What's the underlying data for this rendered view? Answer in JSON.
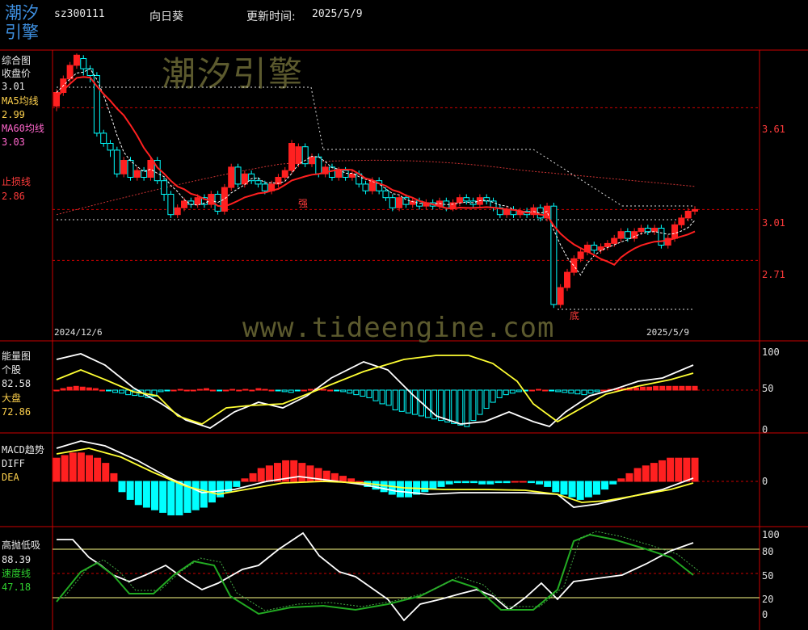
{
  "header": {
    "logo": "潮汐引擎",
    "code": "sz300111",
    "name": "向日葵",
    "update_label": "更新时间:",
    "update_date": "2025/5/9"
  },
  "watermark": {
    "brand": "潮汐引擎",
    "url": "www.tideengine.com"
  },
  "colors": {
    "up": "#ff2020",
    "down": "#00ffff",
    "ma5": "#ffffff",
    "ma60": "#ff2020",
    "grid": "#cc0000",
    "yellow": "#ffff33",
    "green": "#22aa22"
  },
  "panel1": {
    "title": "综合图",
    "close_label": "收盘价",
    "close_value": "3.01",
    "ma5_label": "MA5均线",
    "ma5_value": "2.99",
    "ma60_label": "MA60均线",
    "ma60_value": "3.03",
    "stop_label": "止损线",
    "stop_value": "2.86",
    "y_ticks": [
      "3.61",
      "3.01",
      "2.71"
    ],
    "date_start": "2024/12/6",
    "date_end": "2025/5/9",
    "marker_strong": "强",
    "marker_bottom": "底"
  },
  "panel2": {
    "title": "能量图",
    "stock_label": "个股",
    "stock_value": "82.58",
    "market_label": "大盘",
    "market_value": "72.86",
    "y_ticks": [
      "100",
      "50",
      "0"
    ]
  },
  "panel3": {
    "title": "MACD趋势",
    "diff_label": "DIFF",
    "dea_label": "DEA",
    "y_ticks": [
      "0"
    ]
  },
  "panel4": {
    "title": "高抛低吸",
    "value": "88.39",
    "speed_label": "速度线",
    "speed_value": "47.18",
    "y_ticks": [
      "100",
      "80",
      "50",
      "20",
      "0"
    ]
  },
  "chart_data": {
    "type": "candlestick",
    "x_range": [
      "2024/12/6",
      "2025/5/9"
    ],
    "price_ylim": [
      2.35,
      3.95
    ],
    "candles": [
      [
        3.62,
        3.7,
        3.59,
        3.72
      ],
      [
        3.7,
        3.78,
        3.68,
        3.8
      ],
      [
        3.78,
        3.86,
        3.76,
        3.88
      ],
      [
        3.86,
        3.92,
        3.84,
        3.93
      ],
      [
        3.9,
        3.84,
        3.8,
        3.92
      ],
      [
        3.84,
        3.8,
        3.76,
        3.86
      ],
      [
        3.8,
        3.46,
        3.44,
        3.82
      ],
      [
        3.46,
        3.4,
        3.38,
        3.48
      ],
      [
        3.4,
        3.36,
        3.32,
        3.42
      ],
      [
        3.36,
        3.22,
        3.2,
        3.38
      ],
      [
        3.22,
        3.3,
        3.2,
        3.32
      ],
      [
        3.3,
        3.2,
        3.18,
        3.32
      ],
      [
        3.2,
        3.24,
        3.18,
        3.26
      ],
      [
        3.24,
        3.2,
        3.18,
        3.26
      ],
      [
        3.2,
        3.3,
        3.18,
        3.32
      ],
      [
        3.3,
        3.18,
        3.16,
        3.32
      ],
      [
        3.18,
        3.1,
        3.06,
        3.2
      ],
      [
        3.1,
        2.98,
        2.96,
        3.12
      ],
      [
        2.98,
        3.02,
        2.96,
        3.04
      ],
      [
        3.02,
        3.06,
        3.0,
        3.08
      ],
      [
        3.06,
        3.04,
        3.02,
        3.08
      ],
      [
        3.04,
        3.08,
        3.02,
        3.1
      ],
      [
        3.08,
        3.04,
        3.02,
        3.1
      ],
      [
        3.04,
        3.1,
        3.02,
        3.12
      ],
      [
        3.1,
        3.0,
        2.98,
        3.12
      ],
      [
        3.0,
        3.14,
        2.98,
        3.16
      ],
      [
        3.14,
        3.26,
        3.12,
        3.28
      ],
      [
        3.26,
        3.16,
        3.14,
        3.28
      ],
      [
        3.16,
        3.22,
        3.14,
        3.24
      ],
      [
        3.22,
        3.18,
        3.16,
        3.24
      ],
      [
        3.18,
        3.16,
        3.14,
        3.2
      ],
      [
        3.16,
        3.12,
        3.1,
        3.18
      ],
      [
        3.12,
        3.16,
        3.1,
        3.18
      ],
      [
        3.16,
        3.2,
        3.14,
        3.22
      ],
      [
        3.2,
        3.24,
        3.18,
        3.26
      ],
      [
        3.24,
        3.4,
        3.22,
        3.42
      ],
      [
        3.28,
        3.38,
        3.26,
        3.4
      ],
      [
        3.38,
        3.28,
        3.26,
        3.4
      ],
      [
        3.28,
        3.32,
        3.26,
        3.34
      ],
      [
        3.32,
        3.22,
        3.2,
        3.34
      ],
      [
        3.22,
        3.26,
        3.2,
        3.28
      ],
      [
        3.26,
        3.2,
        3.18,
        3.28
      ],
      [
        3.2,
        3.24,
        3.18,
        3.26
      ],
      [
        3.24,
        3.2,
        3.18,
        3.26
      ],
      [
        3.2,
        3.22,
        3.18,
        3.24
      ],
      [
        3.22,
        3.16,
        3.14,
        3.24
      ],
      [
        3.16,
        3.12,
        3.1,
        3.18
      ],
      [
        3.12,
        3.18,
        3.1,
        3.2
      ],
      [
        3.18,
        3.12,
        3.1,
        3.2
      ],
      [
        3.12,
        3.08,
        3.06,
        3.14
      ],
      [
        3.08,
        3.02,
        3.0,
        3.1
      ],
      [
        3.02,
        3.08,
        3.0,
        3.1
      ],
      [
        3.08,
        3.04,
        3.02,
        3.1
      ],
      [
        3.04,
        3.06,
        3.02,
        3.08
      ],
      [
        3.06,
        3.03,
        3.01,
        3.08
      ],
      [
        3.03,
        3.05,
        3.01,
        3.07
      ],
      [
        3.05,
        3.03,
        3.01,
        3.07
      ],
      [
        3.03,
        3.06,
        3.01,
        3.08
      ],
      [
        3.06,
        3.02,
        3.0,
        3.08
      ],
      [
        3.02,
        3.05,
        3.0,
        3.07
      ],
      [
        3.05,
        3.08,
        3.03,
        3.1
      ],
      [
        3.08,
        3.06,
        3.04,
        3.1
      ],
      [
        3.06,
        3.04,
        3.02,
        3.08
      ],
      [
        3.04,
        3.08,
        3.02,
        3.1
      ],
      [
        3.08,
        3.06,
        3.04,
        3.1
      ],
      [
        3.06,
        3.02,
        3.0,
        3.08
      ],
      [
        3.02,
        2.98,
        2.96,
        3.04
      ],
      [
        2.98,
        3.01,
        2.96,
        3.03
      ],
      [
        3.01,
        2.98,
        2.96,
        3.03
      ],
      [
        2.98,
        3.0,
        2.96,
        3.02
      ],
      [
        3.0,
        2.98,
        2.96,
        3.02
      ],
      [
        2.98,
        3.02,
        2.96,
        3.04
      ],
      [
        3.02,
        2.96,
        2.94,
        3.04
      ],
      [
        2.96,
        3.03,
        2.94,
        3.05
      ],
      [
        3.03,
        2.45,
        2.43,
        3.05
      ],
      [
        2.45,
        2.55,
        2.43,
        2.57
      ],
      [
        2.55,
        2.64,
        2.53,
        2.66
      ],
      [
        2.64,
        2.72,
        2.62,
        2.74
      ],
      [
        2.72,
        2.76,
        2.7,
        2.78
      ],
      [
        2.76,
        2.8,
        2.74,
        2.82
      ],
      [
        2.8,
        2.77,
        2.75,
        2.82
      ],
      [
        2.77,
        2.79,
        2.75,
        2.81
      ],
      [
        2.79,
        2.81,
        2.77,
        2.83
      ],
      [
        2.81,
        2.84,
        2.79,
        2.86
      ],
      [
        2.84,
        2.88,
        2.82,
        2.9
      ],
      [
        2.88,
        2.84,
        2.82,
        2.9
      ],
      [
        2.84,
        2.88,
        2.82,
        2.9
      ],
      [
        2.88,
        2.9,
        2.86,
        2.92
      ],
      [
        2.9,
        2.88,
        2.86,
        2.92
      ],
      [
        2.88,
        2.9,
        2.86,
        2.92
      ],
      [
        2.9,
        2.8,
        2.78,
        2.92
      ],
      [
        2.8,
        2.84,
        2.78,
        2.86
      ],
      [
        2.84,
        2.92,
        2.82,
        2.94
      ],
      [
        2.92,
        2.96,
        2.9,
        2.98
      ],
      [
        2.96,
        3.0,
        2.94,
        3.02
      ],
      [
        3.0,
        3.01,
        2.98,
        3.03
      ]
    ],
    "volume_energy_bars": [
      50,
      52,
      54,
      55,
      54,
      53,
      52,
      50,
      49,
      47,
      46,
      44,
      43,
      42,
      40,
      42,
      48,
      49,
      50,
      51,
      50,
      50,
      51,
      52,
      50,
      49,
      50,
      51,
      50,
      51,
      50,
      52,
      51,
      50,
      49,
      48,
      47,
      49,
      50,
      51,
      52,
      51,
      50,
      49,
      48,
      46,
      44,
      42,
      40,
      36,
      32,
      30,
      24,
      22,
      20,
      18,
      16,
      14,
      12,
      10,
      8,
      6,
      4,
      2,
      10,
      18,
      26,
      34,
      40,
      44,
      46,
      48,
      49,
      50,
      51,
      50,
      49,
      48,
      47,
      46,
      45,
      44,
      46,
      48,
      50,
      51,
      52,
      52,
      53,
      53,
      54,
      54,
      55,
      55,
      55,
      55,
      55,
      55,
      55
    ],
    "macd_bars": [
      18,
      20,
      22,
      22,
      20,
      18,
      14,
      6,
      -8,
      -14,
      -18,
      -20,
      -22,
      -24,
      -26,
      -26,
      -24,
      -22,
      -20,
      -16,
      -12,
      -8,
      -4,
      2,
      6,
      10,
      12,
      14,
      16,
      16,
      14,
      12,
      10,
      8,
      6,
      4,
      2,
      0,
      -4,
      -6,
      -8,
      -10,
      -12,
      -12,
      -10,
      -8,
      -6,
      -4,
      -2,
      -1,
      -1,
      -1,
      -2,
      -2,
      -1,
      -1,
      0,
      0,
      -1,
      -2,
      -4,
      -8,
      -10,
      -12,
      -14,
      -12,
      -10,
      -6,
      -2,
      2,
      6,
      10,
      12,
      14,
      16,
      18,
      18,
      18,
      18
    ],
    "gaoxi_ylim": [
      0,
      100
    ]
  }
}
